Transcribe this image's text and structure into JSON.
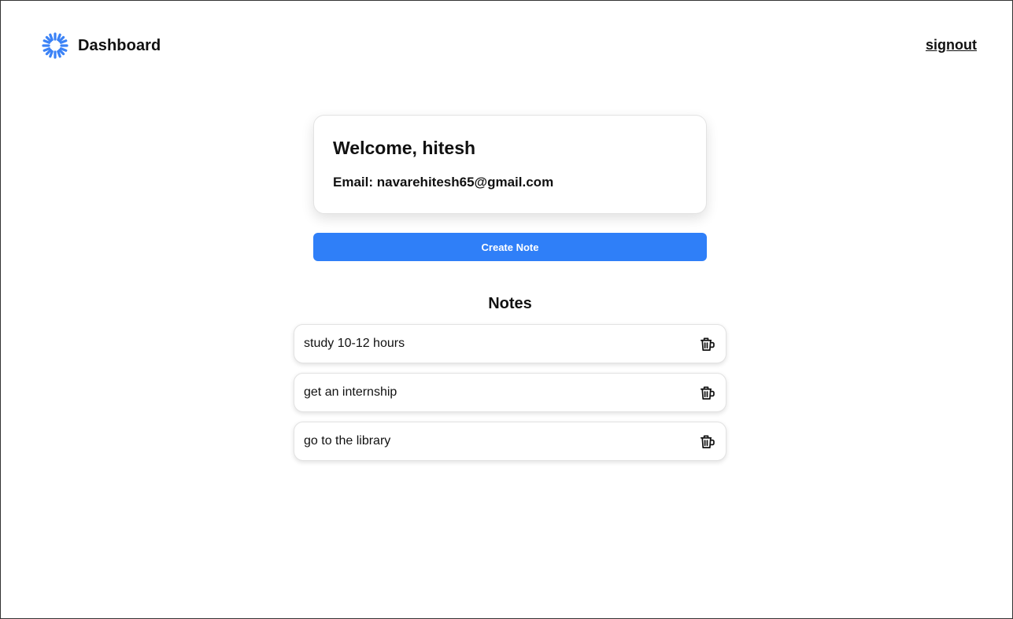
{
  "header": {
    "logo_icon": "loader-spinner-icon",
    "title": "Dashboard",
    "signout_label": "signout"
  },
  "welcome": {
    "greeting": "Welcome, hitesh",
    "email_line": "Email: navarehitesh65@gmail.com"
  },
  "actions": {
    "create_note_label": "Create Note"
  },
  "notes": {
    "heading": "Notes",
    "delete_icon": "trash-icon",
    "items": [
      {
        "text": "study 10-12 hours"
      },
      {
        "text": "get an internship"
      },
      {
        "text": "go to the library"
      }
    ]
  },
  "colors": {
    "accent": "#2f7ff8",
    "logo": "#3b82f6"
  }
}
